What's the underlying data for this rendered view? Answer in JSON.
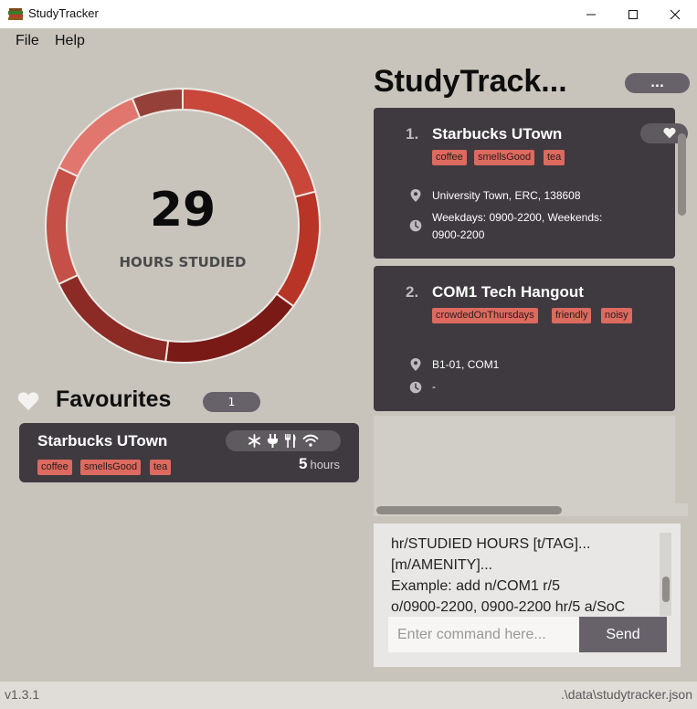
{
  "window": {
    "title": "StudyTracker",
    "icon": "books-icon"
  },
  "menu": {
    "items": [
      "File",
      "Help"
    ]
  },
  "stats": {
    "hours_value": "29",
    "hours_caption": "HOURS STUDIED",
    "segments": [
      {
        "share": 0.21,
        "color": "#c8463a"
      },
      {
        "share": 0.14,
        "color": "#b83426"
      },
      {
        "share": 0.17,
        "color": "#7a1a16"
      },
      {
        "share": 0.16,
        "color": "#8c2a26"
      },
      {
        "share": 0.14,
        "color": "#c45048"
      },
      {
        "share": 0.12,
        "color": "#e0766e"
      },
      {
        "share": 0.06,
        "color": "#96403a"
      }
    ]
  },
  "favourites": {
    "title": "Favourites",
    "count": "1",
    "card": {
      "name": "Starbucks UTown",
      "tags": [
        "coffee",
        "smellsGood",
        "tea"
      ],
      "amenities": [
        "snowflake-icon",
        "plug-icon",
        "utensils-icon",
        "wifi-icon"
      ],
      "hours_value": "5",
      "hours_unit": "hours"
    }
  },
  "list": {
    "title": "StudyTrack...",
    "more_label": "...",
    "items": [
      {
        "index": "1.",
        "name": "Starbucks UTown",
        "tags": [
          "coffee",
          "smellsGood",
          "tea"
        ],
        "location": "University Town, ERC, 138608",
        "hours_line1": "Weekdays: 0900-2200, Weekends:",
        "hours_line2": "0900-2200"
      },
      {
        "index": "2.",
        "name": "COM1 Tech Hangout",
        "tags": [
          "crowdedOnThursdays",
          "friendly",
          "noisy"
        ],
        "location": "B1-01, COM1",
        "hours_line1": "-",
        "hours_line2": ""
      }
    ]
  },
  "result": {
    "lines": [
      "hr/STUDIED HOURS [t/TAG]...",
      "[m/AMENITY]...",
      "Example: add n/COM1 r/5",
      "o/0900-2200, 0900-2200 hr/5 a/SoC"
    ]
  },
  "command": {
    "placeholder": "Enter command here...",
    "send_label": "Send"
  },
  "status": {
    "version": "v1.3.1",
    "path": ".\\data\\studytracker.json"
  },
  "colors": {
    "background": "#c8c4bc",
    "card": "#3f3a40",
    "tag": "#dc6a5f",
    "button": "#67626a"
  }
}
